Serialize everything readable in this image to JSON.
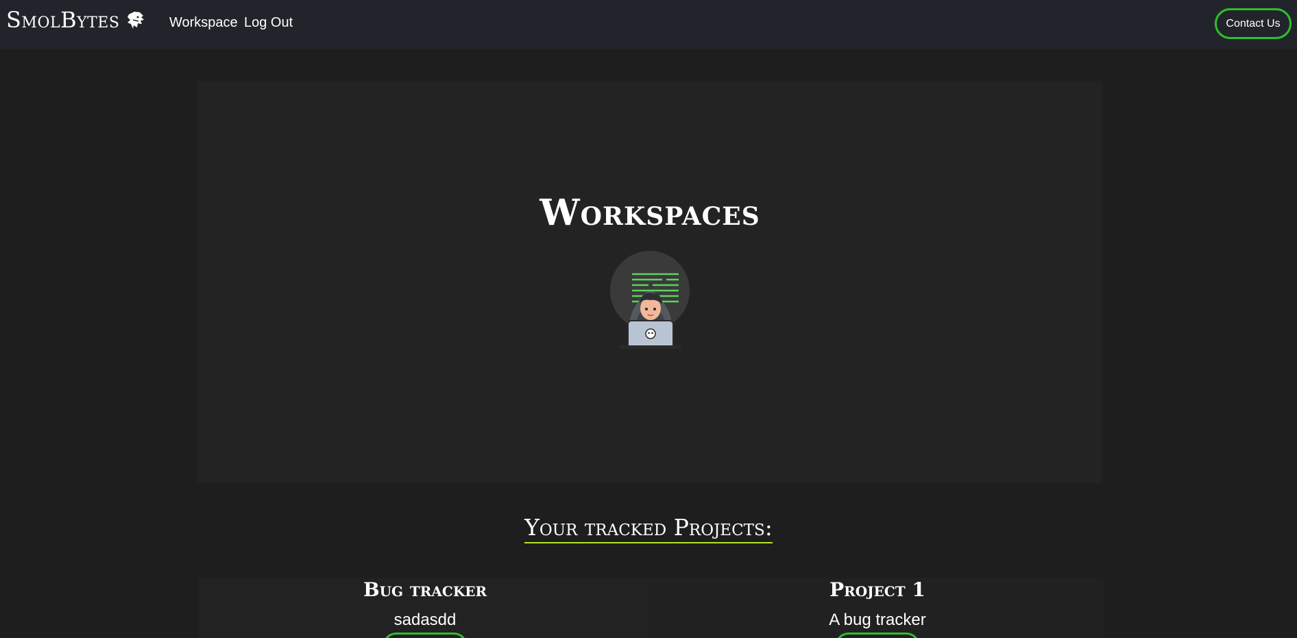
{
  "navbar": {
    "brand": "SmolBytes",
    "brand_icon": "lion-head-icon",
    "links": [
      {
        "label": "Workspace"
      },
      {
        "label": "Log Out"
      }
    ],
    "contact_label": "Contact Us"
  },
  "hero": {
    "title": "Workspaces",
    "avatar_icon": "hooded-coder-icon"
  },
  "projects_section": {
    "title": "Your tracked Projects:",
    "projects": [
      {
        "name": "Bug tracker",
        "description": "sadasdd"
      },
      {
        "name": "Project 1",
        "description": "A bug tracker"
      }
    ]
  },
  "colors": {
    "accent_green": "#2fbf2f",
    "underline_lime": "#b5e61d",
    "navbar_bg": "#21252b",
    "page_bg": "#1e1e1e"
  }
}
